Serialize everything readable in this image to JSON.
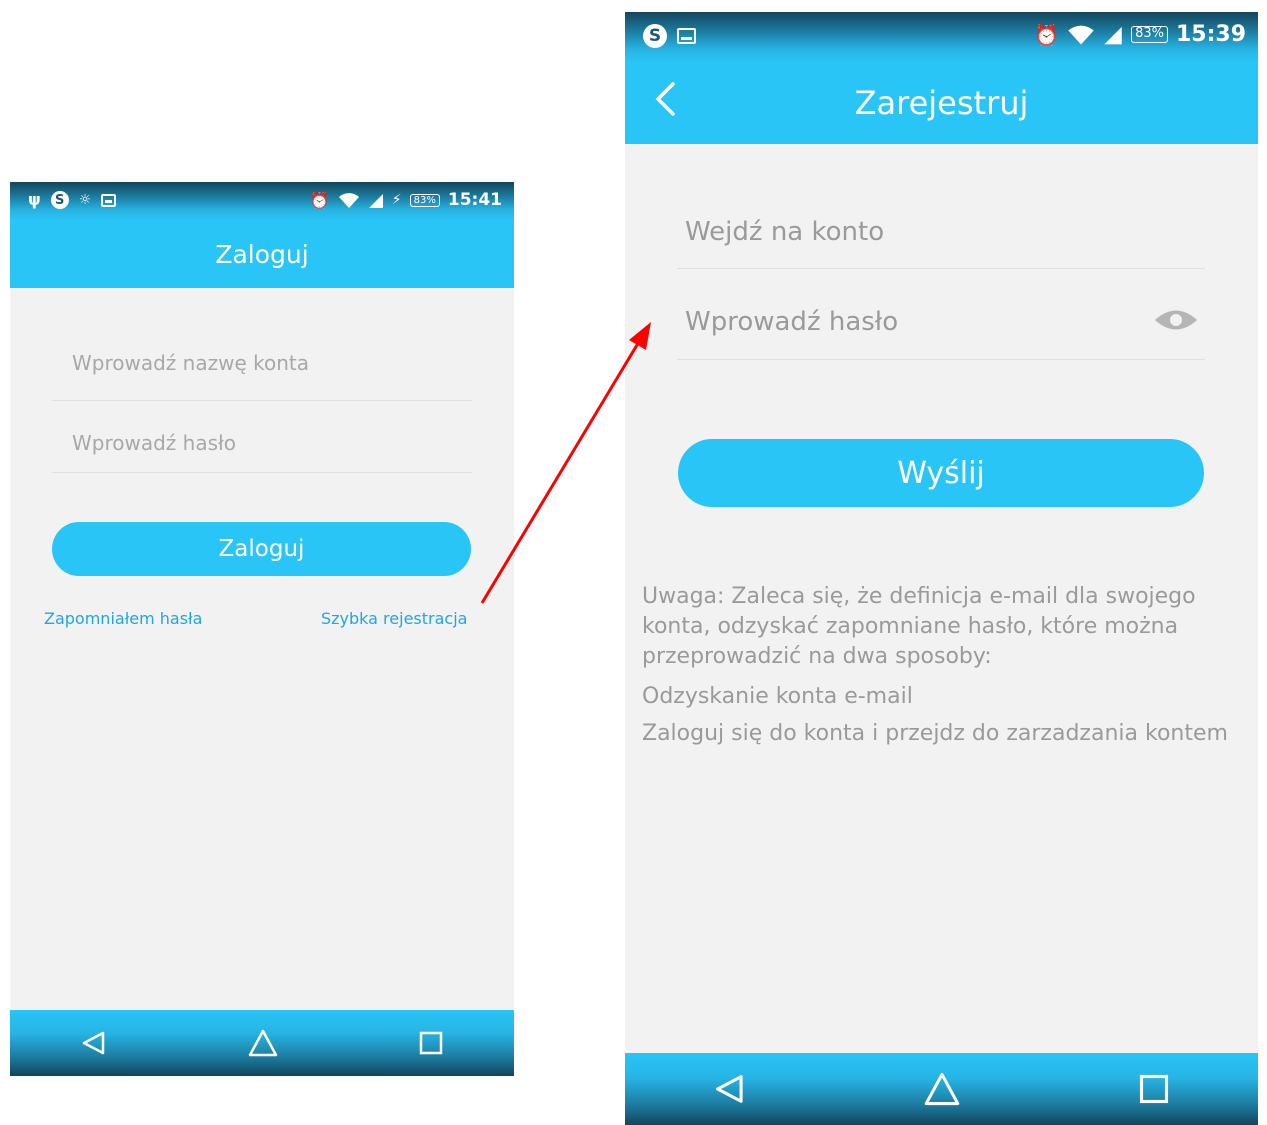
{
  "login": {
    "status": {
      "time": "15:41",
      "battery": "83%",
      "icons": [
        "usb-icon",
        "skype-icon",
        "bulb-icon",
        "image-icon",
        "alarm-icon",
        "wifi-icon",
        "signal-icon",
        "charging-icon"
      ]
    },
    "title": "Zaloguj",
    "account_placeholder": "Wprowadź nazwę konta",
    "password_placeholder": "Wprowadź hasło",
    "login_button": "Zaloguj",
    "forgot_link": "Zapomniałem hasła",
    "register_link": "Szybka rejestracja"
  },
  "register": {
    "status": {
      "time": "15:39",
      "battery": "83%",
      "icons": [
        "skype-icon",
        "image-icon",
        "alarm-icon",
        "wifi-icon",
        "signal-icon"
      ]
    },
    "title": "Zarejestruj",
    "account_placeholder": "Wejdź na konto",
    "password_placeholder": "Wprowadź hasło",
    "submit_button": "Wyślij",
    "note_line1": "Uwaga: Zaleca się, że definicja e-mail dla swojego",
    "note_line2": "konta, odzyskać zapomniane hasło, które można",
    "note_line3": "przeprowadzić na dwa sposoby:",
    "option1": "Odzyskanie konta e-mail",
    "option2": "Zaloguj się do konta i przejdz do zarzadzania kontem"
  },
  "nav": [
    "back-icon",
    "home-icon",
    "recents-icon"
  ],
  "colors": {
    "accent": "#29c5f6",
    "link": "#1ea8e0",
    "arrow": "#ff0000",
    "background": "#f2f2f2"
  }
}
